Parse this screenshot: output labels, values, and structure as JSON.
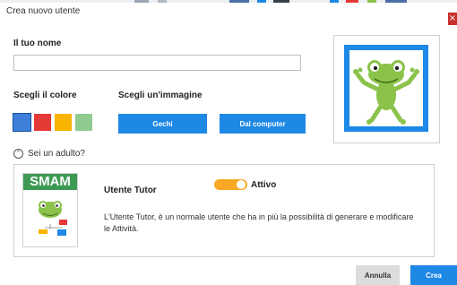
{
  "dialog": {
    "title": "Crea nuovo utente",
    "close_glyph": "×"
  },
  "name_section": {
    "label": "Il tuo nome",
    "value": "",
    "placeholder": ""
  },
  "color_section": {
    "label": "Scegli il colore",
    "swatches": [
      "#3d7fd9",
      "#e53935",
      "#f9b400",
      "#8fca8f"
    ],
    "selected_index": 0
  },
  "image_section": {
    "label": "Scegli un'immagine",
    "gechi_label": "Gechi",
    "computer_label": "Dal computer"
  },
  "adult_toggle": {
    "label": "Sei un adulto?",
    "icon": "chevron-up-icon"
  },
  "tutor": {
    "logo_text": "SMAM",
    "title": "Utente Tutor",
    "switch_label": "Attivo",
    "active": true,
    "description": "L'Utente Tutor, è un normale utente che ha in più la possibilità di generare e modificare le Attività."
  },
  "footer": {
    "cancel_label": "Annulla",
    "create_label": "Crea"
  },
  "colors": {
    "accent": "#1e88e5",
    "toggle_on": "#f9a825",
    "gecko": "#8bc34a",
    "smam_green": "#3d9a53"
  }
}
